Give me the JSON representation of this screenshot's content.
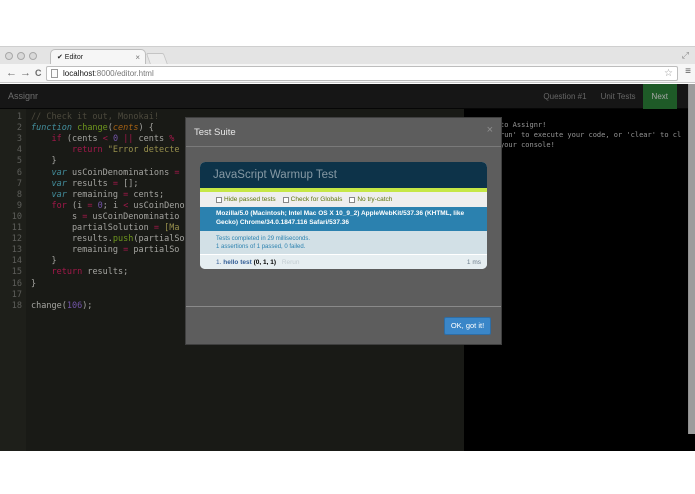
{
  "browser": {
    "tab_title": "✔ Editor",
    "tab_close": "×",
    "url_host": "localhost",
    "url_path": ":8000/editor.html",
    "back": "←",
    "forward": "→",
    "reload": "C",
    "star": "☆",
    "menu": "≡",
    "resize": "⤢"
  },
  "app": {
    "brand": "Assignr",
    "nav": [
      "Question #1",
      "Unit Tests",
      "Next"
    ]
  },
  "editor": {
    "lines": [
      {
        "n": "1",
        "segs": [
          [
            "c-com",
            "// Check it out, Monokai!"
          ]
        ]
      },
      {
        "n": "2",
        "segs": [
          [
            "c-st",
            "function"
          ],
          [
            "",
            " "
          ],
          [
            "c-fn",
            "change"
          ],
          [
            "",
            "("
          ],
          [
            "c-pa",
            "cents"
          ],
          [
            "",
            ") {"
          ]
        ]
      },
      {
        "n": "3",
        "segs": [
          [
            "",
            "    "
          ],
          [
            "c-kw",
            "if"
          ],
          [
            "",
            " (cents "
          ],
          [
            "c-kw",
            "<"
          ],
          [
            "",
            " "
          ],
          [
            "c-nu",
            "0"
          ],
          [
            "",
            " "
          ],
          [
            "c-kw",
            "||"
          ],
          [
            "",
            " cents "
          ],
          [
            "c-kw",
            "%"
          ]
        ]
      },
      {
        "n": "4",
        "segs": [
          [
            "",
            "        "
          ],
          [
            "c-kw",
            "return"
          ],
          [
            "",
            " "
          ],
          [
            "c-str",
            "\"Error detecte"
          ]
        ]
      },
      {
        "n": "5",
        "segs": [
          [
            "",
            "    }"
          ]
        ]
      },
      {
        "n": "6",
        "segs": [
          [
            "",
            "    "
          ],
          [
            "c-st",
            "var"
          ],
          [
            "",
            " usCoinDenominations "
          ],
          [
            "c-kw",
            "="
          ]
        ]
      },
      {
        "n": "7",
        "segs": [
          [
            "",
            "    "
          ],
          [
            "c-st",
            "var"
          ],
          [
            "",
            " results "
          ],
          [
            "c-kw",
            "="
          ],
          [
            "",
            " [];"
          ]
        ]
      },
      {
        "n": "8",
        "segs": [
          [
            "",
            "    "
          ],
          [
            "c-st",
            "var"
          ],
          [
            "",
            " remaining "
          ],
          [
            "c-kw",
            "="
          ],
          [
            "",
            " cents;"
          ]
        ]
      },
      {
        "n": "9",
        "segs": [
          [
            "",
            "    "
          ],
          [
            "c-kw",
            "for"
          ],
          [
            "",
            " (i "
          ],
          [
            "c-kw",
            "="
          ],
          [
            "",
            " "
          ],
          [
            "c-nu",
            "0"
          ],
          [
            "",
            "; i "
          ],
          [
            "c-kw",
            "<"
          ],
          [
            "",
            " usCoinDeno"
          ]
        ]
      },
      {
        "n": "10",
        "segs": [
          [
            "",
            "        s "
          ],
          [
            "c-kw",
            "="
          ],
          [
            "",
            " usCoinDenominatio"
          ]
        ]
      },
      {
        "n": "11",
        "segs": [
          [
            "",
            "        partialSolution "
          ],
          [
            "c-kw",
            "="
          ],
          [
            "",
            " "
          ],
          [
            "c-str",
            "[Ma"
          ]
        ]
      },
      {
        "n": "12",
        "segs": [
          [
            "",
            "        results."
          ],
          [
            "c-fn",
            "push"
          ],
          [
            "",
            "(partialSo"
          ]
        ]
      },
      {
        "n": "13",
        "segs": [
          [
            "",
            "        remaining "
          ],
          [
            "c-kw",
            "="
          ],
          [
            "",
            " partialSo"
          ]
        ]
      },
      {
        "n": "14",
        "segs": [
          [
            "",
            "    }"
          ]
        ]
      },
      {
        "n": "15",
        "segs": [
          [
            "",
            "    "
          ],
          [
            "c-kw",
            "return"
          ],
          [
            "",
            " results;"
          ]
        ]
      },
      {
        "n": "16",
        "segs": [
          [
            "",
            "}"
          ]
        ]
      },
      {
        "n": "17",
        "segs": []
      },
      {
        "n": "18",
        "segs": [
          [
            "",
            "change("
          ],
          [
            "c-nu",
            "106"
          ],
          [
            "",
            ");"
          ]
        ]
      }
    ]
  },
  "console": {
    "lines": [
      "to Assignr!",
      "run' to execute your code, or 'clear' to cl",
      "your console!"
    ]
  },
  "modal": {
    "title": "Test Suite",
    "close": "×",
    "ok_label": "OK, got it!",
    "qunit": {
      "header": "JavaScript Warmup Test",
      "toolbar": [
        "Hide passed tests",
        "Check for Globals",
        "No try-catch"
      ],
      "user_agent": "Mozilla/5.0 (Macintosh; Intel Mac OS X 10_9_2) AppleWebKit/537.36 (KHTML, like Gecko) Chrome/34.0.1847.116 Safari/537.36",
      "result_line1": "Tests completed in 29 milliseconds.",
      "result_line2": "1 assertions of 1 passed, 0 failed.",
      "test_index": "1.",
      "test_name": "hello test",
      "test_counts": "(0, 1, 1)",
      "test_rerun": "Rerun",
      "test_runtime": "1 ms"
    }
  }
}
